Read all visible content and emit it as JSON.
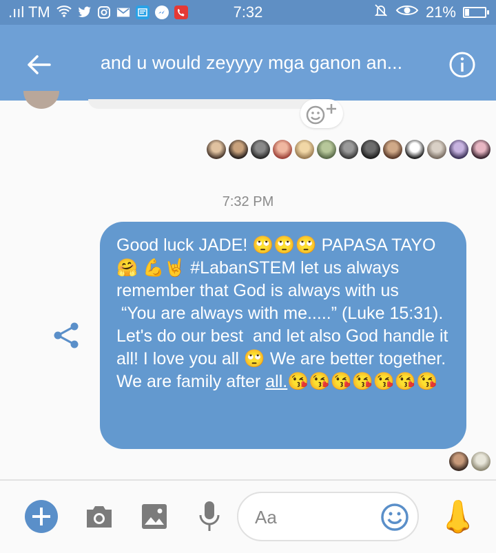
{
  "status_bar": {
    "carrier": ".ııl TM",
    "time": "7:32",
    "battery": "21%",
    "battery_level": 0.21
  },
  "header": {
    "title": "and u would zeyyyy mga ganon an..."
  },
  "reaction_button": {
    "icon": "add-reaction-icon"
  },
  "timestamp": "7:32 PM",
  "message": {
    "text_before_underline": "Good luck JADE! 🙄🙄🙄 PAPASA TAYO 🤗 💪🤘 #LabanSTEM let us always remember that God is always with us\n “You are always with me.....” (Luke 15:31). Let's do our best  and let also God handle it all! I love you all 🙄 We are better together. We are family after ",
    "underlined": "all.",
    "text_after_underline": "😘😘😘😘😘😘😘"
  },
  "composer": {
    "placeholder": "Aa",
    "like_emoji": "👃"
  },
  "colors": {
    "status_bar": "#5f8fc4",
    "app_bar": "#6ea0d6",
    "bubble": "#6399cf",
    "accent": "#5a8fc9"
  }
}
